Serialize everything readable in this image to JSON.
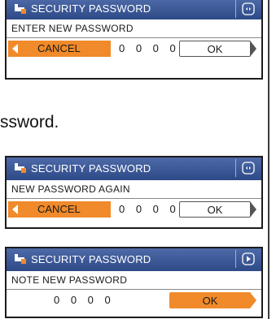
{
  "instruction_fragment": "ssword.",
  "colors": {
    "title_bar": "#2d4a87",
    "accent_orange": "#f08a2a"
  },
  "dialogs": [
    {
      "title": "SECURITY PASSWORD",
      "corner_icon": "sync-icon",
      "prompt": "ENTER NEW PASSWORD",
      "cancel_label": "CANCEL",
      "password_value": "0 0 0 0",
      "ok_label": "OK"
    },
    {
      "title": "SECURITY PASSWORD",
      "corner_icon": "sync-icon",
      "prompt": "NEW PASSWORD AGAIN",
      "cancel_label": "CANCEL",
      "password_value": "0 0 0 0",
      "ok_label": "OK"
    },
    {
      "title": "SECURITY PASSWORD",
      "corner_icon": "play-icon",
      "prompt": "NOTE NEW PASSWORD",
      "password_value": "0 0 0 0",
      "ok_label": "OK"
    }
  ]
}
